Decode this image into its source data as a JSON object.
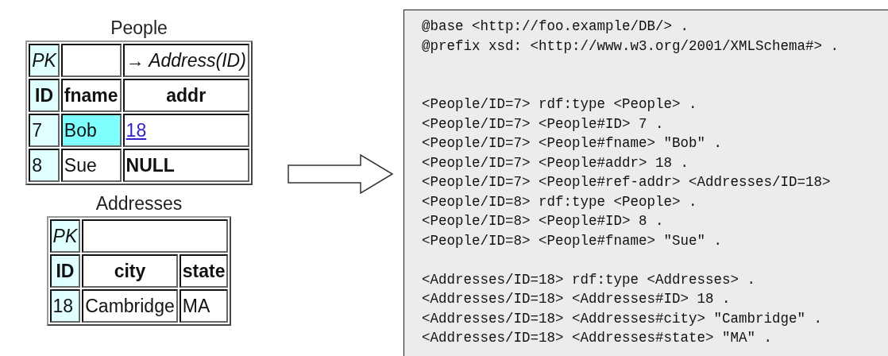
{
  "tables": [
    {
      "caption": "People",
      "rows": [
        [
          {
            "kind": "annotation",
            "key": true,
            "text": "PK"
          },
          {
            "kind": "annotation",
            "key": false
          },
          {
            "kind": "annotation",
            "key": false,
            "text": "→ Address(ID)"
          }
        ],
        [
          {
            "kind": "header",
            "key": true,
            "text": "ID"
          },
          {
            "kind": "header",
            "key": false,
            "text": "fname"
          },
          {
            "kind": "header",
            "key": false,
            "text": "addr"
          }
        ],
        [
          {
            "kind": "data",
            "key": true,
            "text": "7"
          },
          {
            "kind": "highlight",
            "key": false,
            "text": "Bob"
          },
          {
            "kind": "link",
            "key": false,
            "text": "18"
          }
        ],
        [
          {
            "kind": "data",
            "key": true,
            "text": "8"
          },
          {
            "kind": "data",
            "key": false,
            "text": "Sue"
          },
          {
            "kind": "null",
            "key": false,
            "text": "NULL"
          }
        ]
      ]
    },
    {
      "caption": "Addresses",
      "rows": [
        [
          {
            "kind": "annotation",
            "key": true,
            "text": "PK"
          },
          {
            "kind": "annotation",
            "key": false
          }
        ],
        [
          {
            "kind": "header",
            "key": true,
            "text": "ID"
          },
          {
            "kind": "header",
            "key": false,
            "text": "city"
          },
          {
            "kind": "header",
            "key": false,
            "text": "state"
          }
        ],
        [
          {
            "kind": "data",
            "key": true,
            "text": "18"
          },
          {
            "kind": "data",
            "key": false,
            "text": "Cambridge"
          },
          {
            "kind": "data",
            "key": false,
            "text": "MA"
          }
        ]
      ]
    }
  ],
  "code_blocks": [
    {
      "lines": [
        "@base <http://foo.example/DB/> .",
        "@prefix xsd: <http://www.w3.org/2001/XMLSchema#> ."
      ]
    },
    {
      "lines": [
        "<People/ID=7> rdf:type <People> .",
        "<People/ID=7> <People#ID> 7 .",
        "<People/ID=7> <People#fname> \"Bob\" .",
        "<People/ID=7> <People#addr> 18 .",
        "<People/ID=7> <People#ref-addr> <Addresses/ID=18>",
        "<People/ID=8> rdf:type <People> .",
        "<People/ID=8> <People#ID> 8 .",
        "<People/ID=8> <People#fname> \"Sue\" ."
      ]
    },
    {
      "lines": [
        "<Addresses/ID=18> rdf:type <Addresses> .",
        "<Addresses/ID=18> <Addresses#ID> 18 .",
        "<Addresses/ID=18> <Addresses#city> \"Cambridge\" .",
        "<Addresses/ID=18> <Addresses#state> \"MA\" ."
      ]
    }
  ]
}
